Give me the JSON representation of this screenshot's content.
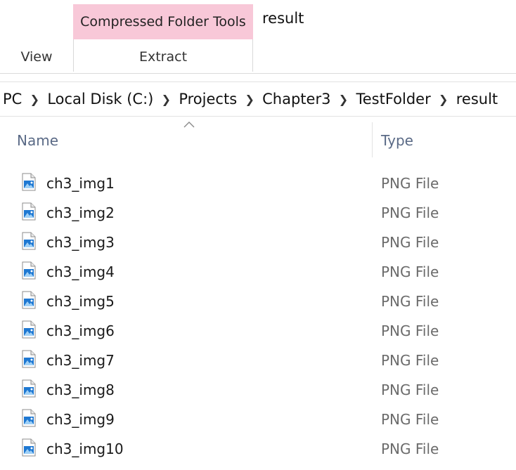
{
  "ribbon": {
    "view_tab": "View",
    "context_group_label": "Compressed Folder Tools",
    "extract_tab": "Extract",
    "context_color": "#f8c8d8"
  },
  "window": {
    "title": "result"
  },
  "address_bar": {
    "crumbs": [
      "PC",
      "Local Disk (C:)",
      "Projects",
      "Chapter3",
      "TestFolder",
      "result"
    ]
  },
  "columns": {
    "name": "Name",
    "type": "Type"
  },
  "files": [
    {
      "name": "ch3_img1",
      "type": "PNG File"
    },
    {
      "name": "ch3_img2",
      "type": "PNG File"
    },
    {
      "name": "ch3_img3",
      "type": "PNG File"
    },
    {
      "name": "ch3_img4",
      "type": "PNG File"
    },
    {
      "name": "ch3_img5",
      "type": "PNG File"
    },
    {
      "name": "ch3_img6",
      "type": "PNG File"
    },
    {
      "name": "ch3_img7",
      "type": "PNG File"
    },
    {
      "name": "ch3_img8",
      "type": "PNG File"
    },
    {
      "name": "ch3_img9",
      "type": "PNG File"
    },
    {
      "name": "ch3_img10",
      "type": "PNG File"
    }
  ],
  "icons": {
    "file": "image-file-icon",
    "sort": "sort-ascending-icon",
    "separator": "chevron-right-icon"
  }
}
